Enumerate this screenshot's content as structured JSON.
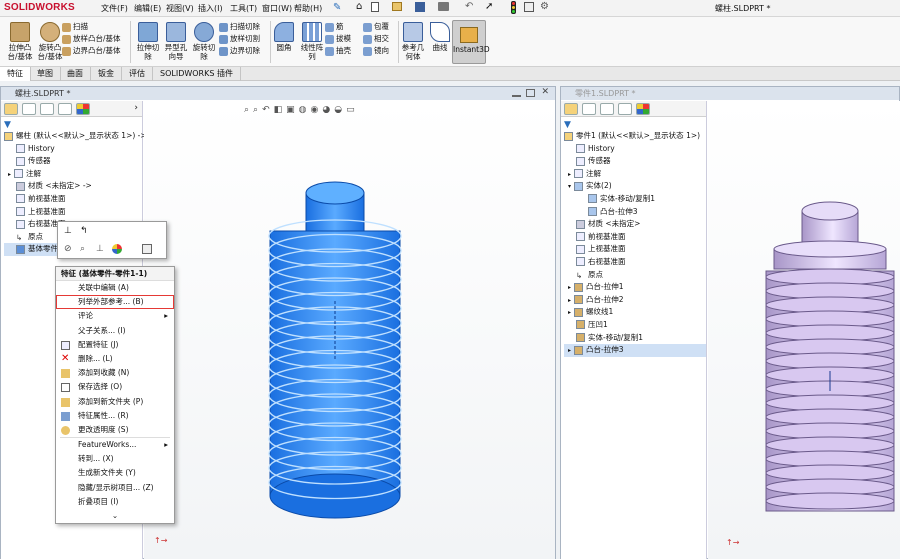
{
  "app": {
    "logo": "SOLIDWORKS",
    "title": "螺柱.SLDPRT *"
  },
  "menu": [
    "文件(F)",
    "编辑(E)",
    "视图(V)",
    "插入(I)",
    "工具(T)",
    "窗口(W)",
    "帮助(H)"
  ],
  "ribbon": {
    "extrude_boss": "拉伸凸\n台/基体",
    "revolve_boss": "旋转凸\n台/基体",
    "sweep": "扫描",
    "loft": "放样凸台/基体",
    "boundary": "边界凸台/基体",
    "extrude_cut": "拉伸切\n除",
    "hole_wizard": "异型孔\n向导",
    "revolve_cut": "旋转切\n除",
    "sweep_cut": "扫描切除",
    "loft_cut": "放样切割",
    "boundary_cut": "边界切除",
    "fillet": "圆角",
    "linear_pattern": "线性阵\n列",
    "rib": "筋",
    "draft": "拔模",
    "shell": "抽壳",
    "wrap": "包覆",
    "intersect": "相交",
    "mirror": "镜向",
    "ref_geometry": "参考几\n何体",
    "curves": "曲线",
    "instant3d": "Instant3D"
  },
  "tabs": [
    "特征",
    "草图",
    "曲面",
    "钣金",
    "评估",
    "SOLIDWORKS 插件"
  ],
  "left_window": {
    "title": "螺柱.SLDPRT *",
    "tree": [
      {
        "label": "螺柱 (默认<<默认>_显示状态 1>) ->"
      },
      {
        "label": "History"
      },
      {
        "label": "传感器"
      },
      {
        "label": "注解"
      },
      {
        "label": "材质 <未指定> ->"
      },
      {
        "label": "前视基准面"
      },
      {
        "label": "上视基准面"
      },
      {
        "label": "右视基准面"
      },
      {
        "label": "原点"
      },
      {
        "label": "基体零件"
      }
    ]
  },
  "context_menu": {
    "header": "特征 (基体零件-零件1-1)",
    "items": [
      {
        "label": "关联中编辑 (A)"
      },
      {
        "label": "列举外部参考... (B)"
      },
      {
        "label": "评论"
      },
      {
        "label": "父子关系... (I)"
      },
      {
        "label": "配置特征 (J)"
      },
      {
        "label": "删除... (L)"
      },
      {
        "label": "添加到收藏 (N)"
      },
      {
        "label": "保存选择 (O)"
      },
      {
        "label": "添加到新文件夹 (P)"
      },
      {
        "label": "特征属性... (R)"
      },
      {
        "label": "更改透明度 (S)"
      },
      {
        "label": "FeatureWorks..."
      },
      {
        "label": "转到... (X)"
      },
      {
        "label": "生成新文件夹 (Y)"
      },
      {
        "label": "隐藏/显示树项目... (Z)"
      },
      {
        "label": "折叠项目 (I)"
      }
    ]
  },
  "right_window": {
    "title": "零件1.SLDPRT *",
    "tree": [
      {
        "label": "零件1 (默认<<默认>_显示状态 1>)"
      },
      {
        "label": "History"
      },
      {
        "label": "传感器"
      },
      {
        "label": "注解"
      },
      {
        "label": "实体(2)"
      },
      {
        "label": "实体-移动/复制1"
      },
      {
        "label": "凸台-拉伸3"
      },
      {
        "label": "材质 <未指定>"
      },
      {
        "label": "前视基准面"
      },
      {
        "label": "上视基准面"
      },
      {
        "label": "右视基准面"
      },
      {
        "label": "原点"
      },
      {
        "label": "凸台-拉伸1"
      },
      {
        "label": "凸台-拉伸2"
      },
      {
        "label": "螺纹线1"
      },
      {
        "label": "压凹1"
      },
      {
        "label": "实体-移动/复制1"
      },
      {
        "label": "凸台-拉伸3"
      }
    ]
  },
  "colors": {
    "selected_part": "#2d8ff0",
    "right_part": "#d8c8f0",
    "highlight_box": "#e53935"
  }
}
